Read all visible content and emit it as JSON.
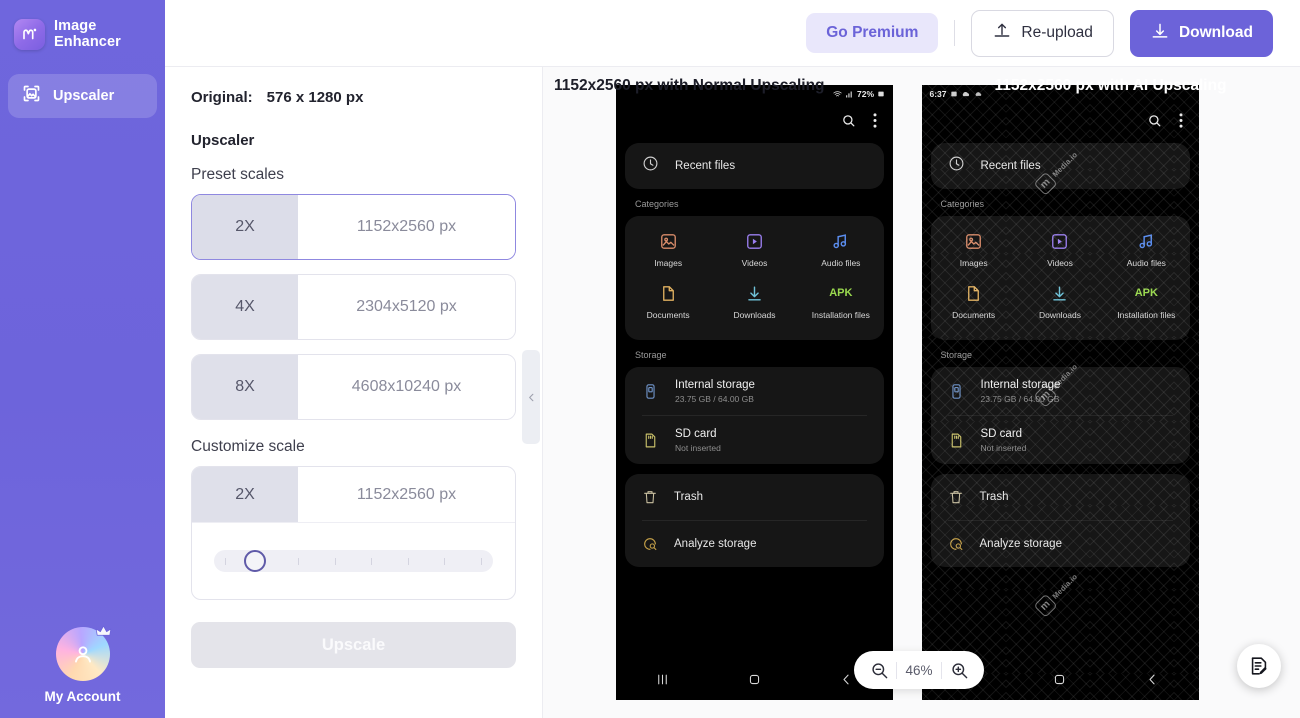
{
  "sidebar": {
    "brand": {
      "name": "Image\nEnhancer",
      "logo_icon": "media-io-logo-icon"
    },
    "items": [
      {
        "label": "Upscaler",
        "icon": "upscale-icon",
        "active": true
      }
    ],
    "account": {
      "label": "My Account",
      "icon": "avatar-crown-icon"
    },
    "colors": {
      "bg": "#6c63d9",
      "active_item": "rgba(255,255,255,.17)"
    }
  },
  "topbar": {
    "premium_label": "Go Premium",
    "reupload_label": "Re-upload",
    "download_label": "Download",
    "accent": "#6c63d9"
  },
  "controls": {
    "original_label": "Original:",
    "original_value": "576 x 1280 px",
    "section_title": "Upscaler",
    "preset_title": "Preset scales",
    "presets": [
      {
        "scale": "2X",
        "size": "1152x2560 px",
        "selected": true
      },
      {
        "scale": "4X",
        "size": "2304x5120 px",
        "selected": false
      },
      {
        "scale": "8X",
        "size": "4608x10240 px",
        "selected": false
      }
    ],
    "customize_title": "Customize scale",
    "custom": {
      "scale": "2X",
      "size": "1152x2560 px",
      "slider_ticks": 8,
      "slider_position_pct": 9
    },
    "upscale_label": "Upscale"
  },
  "preview": {
    "left_pane_title": "1152x2560 px with Normal Upscaling",
    "right_pane_title": "1152x2560 px with AI Upscaling",
    "collapse_icon": "chevron-left-icon",
    "zoom": {
      "level": "46%",
      "out_icon": "zoom-out-icon",
      "in_icon": "zoom-in-icon"
    },
    "feedback_icon": "feedback-edit-icon",
    "watermark": {
      "text": "Media.io",
      "mark": "m"
    }
  },
  "phone": {
    "status": {
      "time": "6:37",
      "battery": "72%",
      "icons": "wifi-signal-battery-icons"
    },
    "toolbar": {
      "search_icon": "search-icon",
      "menu_icon": "more-vertical-icon"
    },
    "recent": {
      "label": "Recent files",
      "icon": "clock-icon"
    },
    "categories_label": "Categories",
    "categories": [
      {
        "label": "Images",
        "icon": "image-icon",
        "color": "#d98c6a"
      },
      {
        "label": "Videos",
        "icon": "video-icon",
        "color": "#9b7ff0"
      },
      {
        "label": "Audio files",
        "icon": "music-note-icon",
        "color": "#5b8ef0"
      },
      {
        "label": "Documents",
        "icon": "document-icon",
        "color": "#e0b060"
      },
      {
        "label": "Downloads",
        "icon": "download-arrow-icon",
        "color": "#6fc2d8"
      },
      {
        "label": "Installation files",
        "icon": "apk-icon",
        "color": "#9ad94f"
      }
    ],
    "storage_label": "Storage",
    "storage": [
      {
        "name": "Internal storage",
        "sub": "23.75 GB / 64.00 GB",
        "icon": "phone-storage-icon"
      },
      {
        "name": "SD card",
        "sub": "Not inserted",
        "icon": "sd-card-icon"
      }
    ],
    "actions": [
      {
        "label": "Trash",
        "icon": "trash-icon"
      },
      {
        "label": "Analyze storage",
        "icon": "analyze-storage-icon"
      }
    ],
    "navbar": {
      "recents_icon": "recents-icon",
      "home_icon": "home-icon",
      "back_icon": "back-icon"
    }
  }
}
